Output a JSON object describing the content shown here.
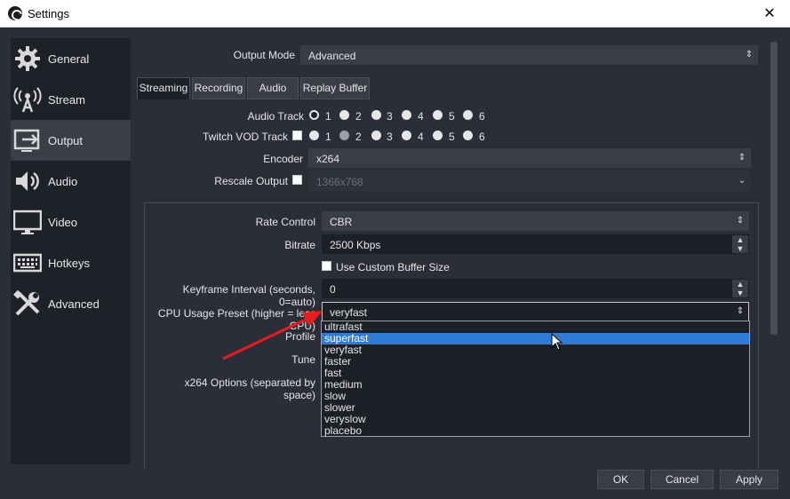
{
  "window": {
    "title": "Settings",
    "close": "✕"
  },
  "sidebar": {
    "items": [
      {
        "label": "General",
        "icon": "gear-icon"
      },
      {
        "label": "Stream",
        "icon": "broadcast-icon"
      },
      {
        "label": "Output",
        "icon": "output-icon"
      },
      {
        "label": "Audio",
        "icon": "speaker-icon"
      },
      {
        "label": "Video",
        "icon": "monitor-icon"
      },
      {
        "label": "Hotkeys",
        "icon": "keyboard-icon"
      },
      {
        "label": "Advanced",
        "icon": "tools-icon"
      }
    ],
    "active": "Output"
  },
  "output_mode": {
    "label": "Output Mode",
    "value": "Advanced"
  },
  "tabs": [
    "Streaming",
    "Recording",
    "Audio",
    "Replay Buffer"
  ],
  "audio_track": {
    "label": "Audio Track",
    "options": [
      "1",
      "2",
      "3",
      "4",
      "5",
      "6"
    ],
    "selected": "1"
  },
  "twitch_vod": {
    "label": "Twitch VOD Track",
    "options": [
      "1",
      "2",
      "3",
      "4",
      "5",
      "6"
    ],
    "selected": "2"
  },
  "encoder": {
    "label": "Encoder",
    "value": "x264"
  },
  "rescale": {
    "label": "Rescale Output",
    "value": "1366x768"
  },
  "rate_control": {
    "label": "Rate Control",
    "value": "CBR"
  },
  "bitrate": {
    "label": "Bitrate",
    "value": "2500 Kbps"
  },
  "custom_buffer": {
    "label": "Use Custom Buffer Size"
  },
  "keyframe": {
    "label": "Keyframe Interval (seconds, 0=auto)",
    "value": "0"
  },
  "cpu_preset": {
    "label": "CPU Usage Preset (higher = less CPU)",
    "value": "veryfast",
    "options": [
      "ultrafast",
      "superfast",
      "veryfast",
      "faster",
      "fast",
      "medium",
      "slow",
      "slower",
      "veryslow",
      "placebo"
    ],
    "highlighted": "superfast"
  },
  "profile": {
    "label": "Profile"
  },
  "tune": {
    "label": "Tune"
  },
  "x264_options": {
    "label": "x264 Options (separated by space)"
  },
  "buttons": {
    "ok": "OK",
    "cancel": "Cancel",
    "apply": "Apply"
  },
  "colors": {
    "highlight": "#2f7bd8",
    "arrow": "#e81c1c"
  }
}
